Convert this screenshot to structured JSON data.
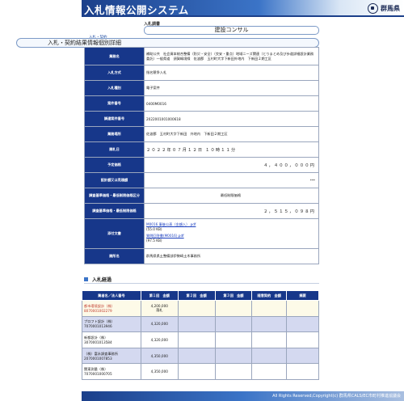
{
  "header": {
    "title": "入札情報公開システム",
    "prefecture": "群馬県"
  },
  "search": {
    "label": "入札調書",
    "value": "建設コンサル"
  },
  "page": {
    "tag": "入札・契約",
    "title": "入札・契約結果情報個別詳細"
  },
  "detail": {
    "rows": [
      {
        "key": "業務名",
        "value": "補助公共　社会資本総合整備（防災・安全）（交安・重点）地域ニーズ関連（とりまとめ及び歩道詳細設計業務委託）一般県道　須賀嶋境線　佐波郡　玉村町大字下新田外地内　下新田２期工区"
      },
      {
        "key": "入札方式",
        "value": "指名競争入札"
      },
      {
        "key": "入札種別",
        "value": "電子案件"
      },
      {
        "key": "案件番号",
        "value": "0400M0016"
      },
      {
        "key": "調達案件番号",
        "value": "2022001001000618"
      },
      {
        "key": "業務場所",
        "value": "佐波郡　玉村町大字下新田　外地内　下新田２期工区"
      },
      {
        "key": "開札日",
        "value": "２０２２年０７月１２日 １０時１１分"
      },
      {
        "key": "予定価格",
        "value": "４，４００，０００円"
      },
      {
        "key": "設計額又は見積額",
        "value": "***"
      },
      {
        "key": "調査基準価格・最低制限価格区分",
        "value": "最低制限価格"
      },
      {
        "key": "調査基準価格・最低制限価格",
        "value": "２，５１５，０９８円"
      },
      {
        "key": "添付文書",
        "files": [
          {
            "name": "M0016 事後公表（金額入）.pdf",
            "size": "(55.0 KB)"
          },
          {
            "name": "質問回答書(M0016).pdf",
            "size": "(97.5 KB)"
          }
        ]
      },
      {
        "key": "開所名",
        "value": "群馬県県土整備部伊勢崎土木事務所"
      }
    ]
  },
  "progress": {
    "title": "入札経過",
    "headers": [
      "業者名／法人番号",
      "第１回　金額",
      "第２回　金額",
      "第３回　金額",
      "随意契約　金額",
      "摘要"
    ],
    "rows": [
      {
        "name": "都市環境設計（株）",
        "id": "8070001002279",
        "amount": "4,200,000",
        "note": "落札",
        "win": true
      },
      {
        "name": "プロフト設計（株）",
        "id": "7070001013946",
        "amount": "4,320,000",
        "note": ""
      },
      {
        "name": "新都設計（株）",
        "id": "3070001013584",
        "amount": "4,320,000",
        "note": ""
      },
      {
        "name": "（株）富永調査事務所",
        "id": "2070001007853",
        "amount": "4,350,000",
        "note": ""
      },
      {
        "name": "関東測量（株）",
        "id": "7070001000705",
        "amount": "4,350,000",
        "note": ""
      }
    ]
  },
  "footer": {
    "text": "All Rights Reserved,Copyright(c) 群馬県CALS/EC市町村推進協議会"
  }
}
